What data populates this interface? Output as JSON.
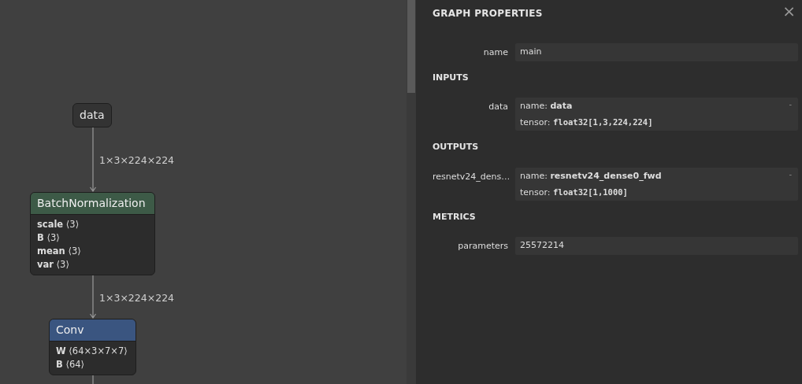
{
  "graph": {
    "nodes": [
      {
        "kind": "input",
        "title": "data"
      },
      {
        "kind": "op",
        "title": "BatchNormalization",
        "color": "#3d5a47",
        "attributes": [
          "**scale** ⟨3⟩",
          "**B** ⟨3⟩",
          "**mean** ⟨3⟩",
          "**var** ⟨3⟩"
        ]
      },
      {
        "kind": "op",
        "title": "Conv",
        "color": "#3a5580",
        "attributes": [
          "**W** ⟨64×3×7×7⟩",
          "**B** ⟨64⟩"
        ]
      }
    ],
    "edges": [
      {
        "kind": "arrow",
        "label": "1×3×224×224"
      },
      {
        "kind": "arrow",
        "label": "1×3×224×224"
      },
      {
        "kind": "line"
      }
    ]
  },
  "panel": {
    "title": "GRAPH PROPERTIES",
    "close": "×",
    "sections": [
      {
        "rows": [
          {
            "label": "name",
            "kind": "plain",
            "value": "main"
          }
        ]
      },
      {
        "heading": "INPUTS",
        "rows": [
          {
            "label": "data",
            "kind": "tensor",
            "expanded": false,
            "toggle": "-",
            "lines": [
              {
                "kind": "name",
                "label": "name:",
                "value": "data"
              },
              {
                "kind": "type",
                "label": "tensor:",
                "value": "float32[1,3,224,224]"
              }
            ]
          }
        ]
      },
      {
        "heading": "OUTPUTS",
        "rows": [
          {
            "label": "resnetv24_dens…",
            "kind": "tensor",
            "expanded": false,
            "toggle": "-",
            "lines": [
              {
                "kind": "name",
                "label": "name:",
                "value": "resnetv24_dense0_fwd"
              },
              {
                "kind": "type",
                "label": "tensor:",
                "value": "float32[1,1000]"
              }
            ]
          }
        ]
      },
      {
        "heading": "METRICS",
        "rows": [
          {
            "label": "parameters",
            "kind": "plain",
            "value": "25572214"
          }
        ]
      }
    ]
  }
}
